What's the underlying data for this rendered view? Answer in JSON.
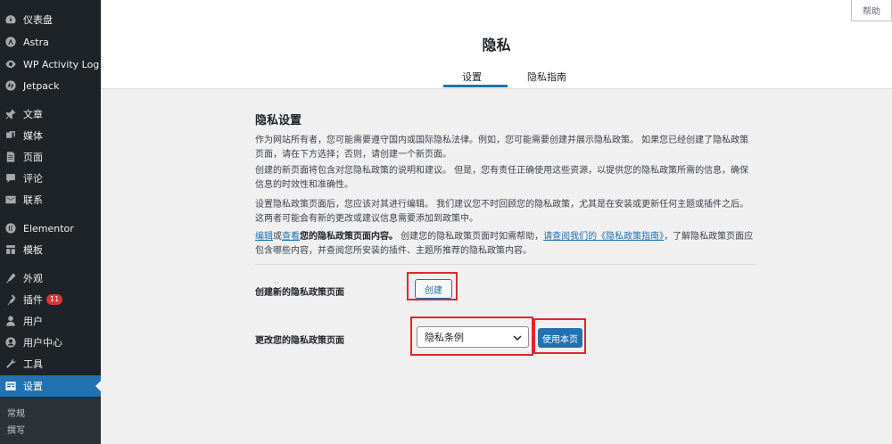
{
  "sidebar": {
    "items": [
      {
        "label": "仪表盘",
        "icon": "dashboard-icon"
      },
      {
        "label": "Astra",
        "icon": "astra-icon"
      },
      {
        "label": "WP Activity Log",
        "icon": "activity-log-icon"
      },
      {
        "label": "Jetpack",
        "icon": "jetpack-icon"
      },
      {
        "label": "文章",
        "icon": "pin-icon"
      },
      {
        "label": "媒体",
        "icon": "media-icon"
      },
      {
        "label": "页面",
        "icon": "page-icon"
      },
      {
        "label": "评论",
        "icon": "comment-icon"
      },
      {
        "label": "联系",
        "icon": "contact-icon"
      },
      {
        "label": "Elementor",
        "icon": "elementor-icon"
      },
      {
        "label": "模板",
        "icon": "template-icon"
      },
      {
        "label": "外观",
        "icon": "appearance-icon"
      },
      {
        "label": "插件",
        "icon": "plugin-icon",
        "badge": "11"
      },
      {
        "label": "用户",
        "icon": "user-icon"
      },
      {
        "label": "用户中心",
        "icon": "user-center-icon"
      },
      {
        "label": "工具",
        "icon": "tools-icon"
      },
      {
        "label": "设置",
        "icon": "settings-icon",
        "active": true
      }
    ],
    "submenu": [
      "常规",
      "撰写"
    ]
  },
  "header": {
    "title": "隐私",
    "tabs": [
      {
        "label": "设置",
        "active": true
      },
      {
        "label": "隐私指南",
        "active": false
      }
    ],
    "help_label": "帮助"
  },
  "content": {
    "section_title": "隐私设置",
    "para1": "作为网站所有者，您可能需要遵守国内或国际隐私法律。例如，您可能需要创建并展示隐私政策。 如果您已经创建了隐私政策页面，请在下方选择；否则，请创建一个新页面。",
    "para2": "创建的新页面将包含对您隐私政策的说明和建议。 但是，您有责任正确使用这些资源，以提供您的隐私政策所需的信息，确保信息的时效性和准确性。",
    "para3": "设置隐私政策页面后，您应该对其进行编辑。 我们建议您不时回顾您的隐私政策，尤其是在安装或更新任何主题或插件之后。 这两者可能会有新的更改或建议信息需要添加到政策中。",
    "para4": {
      "edit_link": "编辑",
      "or": "或",
      "view_link": "查看",
      "bold_text": "您的隐私政策页面内容。",
      "text1": " 创建您的隐私政策页面时如需帮助，",
      "guide_link": "请查阅我们的《隐私政策指南》",
      "text2": "，了解隐私政策页面应包含哪些内容，并查阅您所安装的插件、主题所推荐的隐私政策内容。"
    },
    "create_label": "创建新的隐私政策页面",
    "create_button": "创建",
    "change_label": "更改您的隐私政策页面",
    "select_value": "隐私条例",
    "use_button": "使用本页"
  },
  "colors": {
    "sidebar_bg": "#1d2327",
    "accent": "#2271b1",
    "highlight_red": "#e1262c"
  }
}
